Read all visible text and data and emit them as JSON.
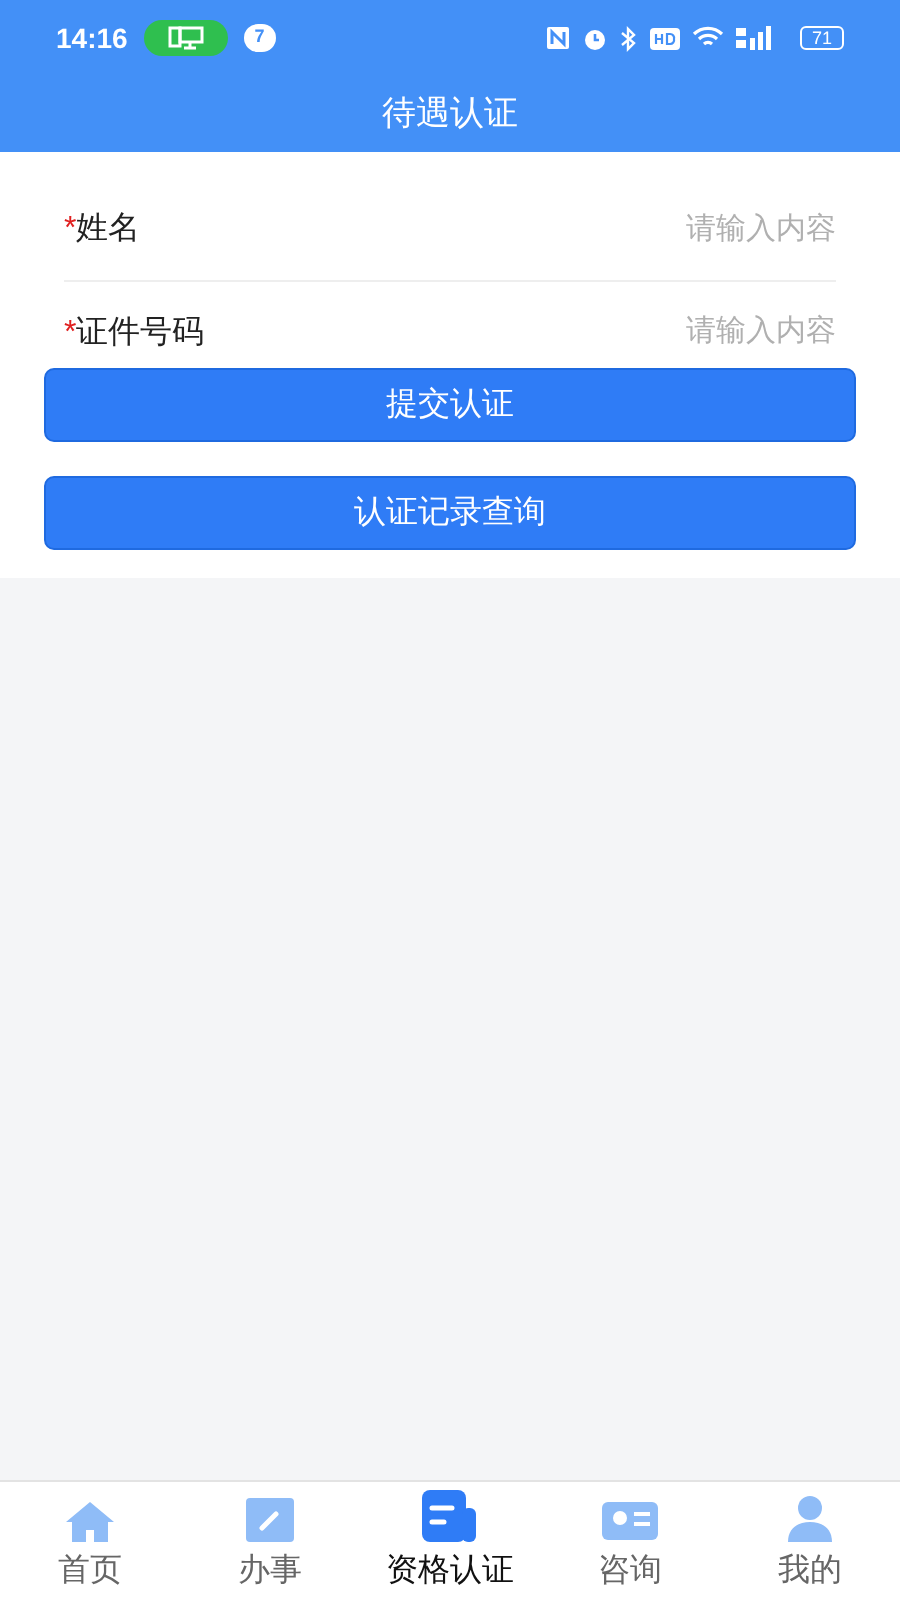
{
  "status_bar": {
    "time": "14:16",
    "notification_count": "7",
    "battery": "71"
  },
  "header": {
    "title": "待遇认证"
  },
  "form": {
    "fields": [
      {
        "required_mark": "*",
        "label": "姓名",
        "placeholder": "请输入内容"
      },
      {
        "required_mark": "*",
        "label": "证件号码",
        "placeholder": "请输入内容"
      }
    ]
  },
  "buttons": [
    "提交认证",
    "认证记录查询"
  ],
  "tab_bar": [
    {
      "kind": "home",
      "label": "首页",
      "selected": false
    },
    {
      "kind": "tasks",
      "label": "办事",
      "selected": false
    },
    {
      "kind": "certify",
      "label": "资格认证",
      "selected": true
    },
    {
      "kind": "consult",
      "label": "咨询",
      "selected": false
    },
    {
      "kind": "profile",
      "label": "我的",
      "selected": false
    }
  ]
}
